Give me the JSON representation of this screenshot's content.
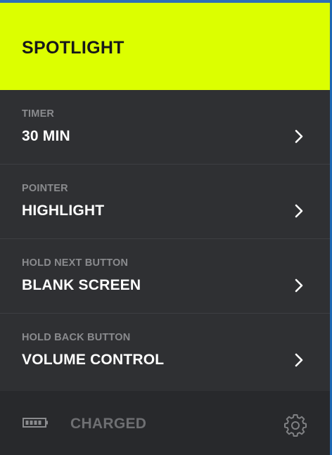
{
  "header": {
    "title": "SPOTLIGHT"
  },
  "menu": {
    "items": [
      {
        "label": "TIMER",
        "value": "30 MIN"
      },
      {
        "label": "POINTER",
        "value": "HIGHLIGHT"
      },
      {
        "label": "HOLD NEXT BUTTON",
        "value": "BLANK SCREEN"
      },
      {
        "label": "HOLD BACK BUTTON",
        "value": "VOLUME CONTROL"
      }
    ]
  },
  "footer": {
    "status": "CHARGED"
  },
  "icons": {
    "chevron": "chevron-right-icon",
    "battery": "battery-icon",
    "settings": "gear-icon"
  },
  "colors": {
    "header_accent": "#dcff00",
    "panel_bg": "#2f3033",
    "footer_bg": "#28292c",
    "window_border": "#1d67b3"
  }
}
